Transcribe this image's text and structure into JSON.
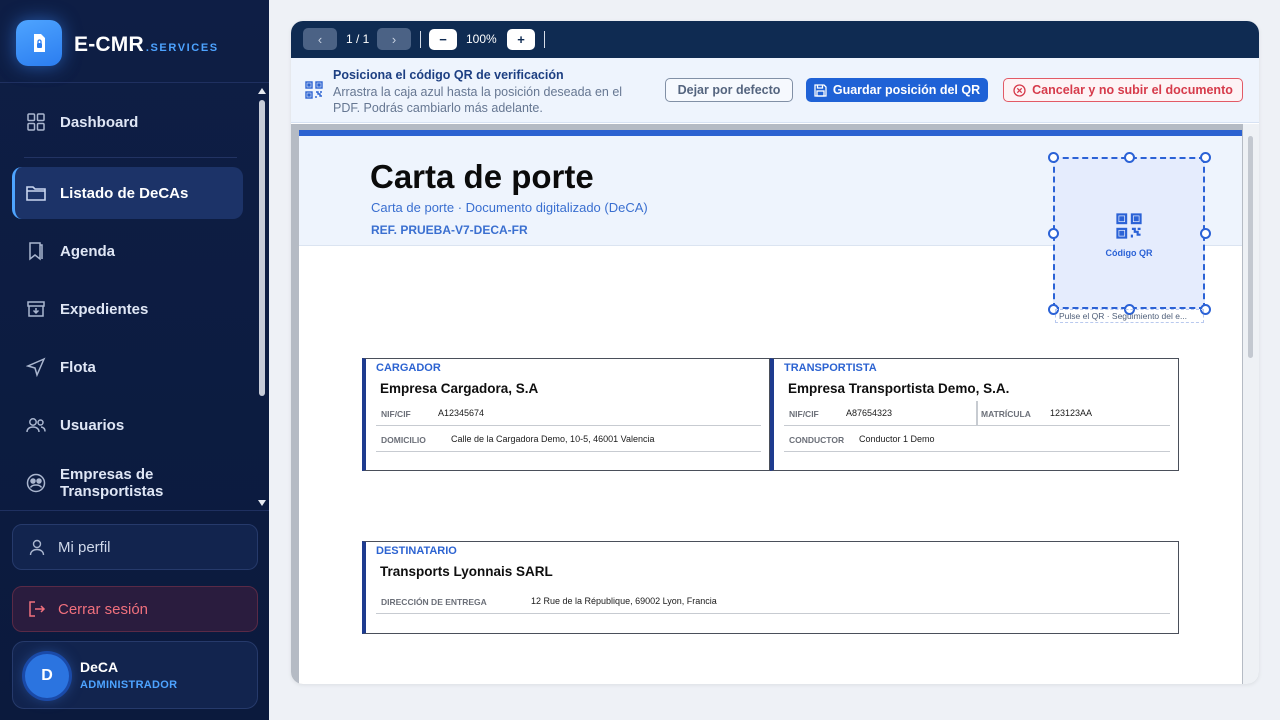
{
  "brand": {
    "name": "E-CMR",
    "sub": ".SERVICES"
  },
  "nav": {
    "items": [
      {
        "label": "Dashboard",
        "icon": "grid-icon"
      },
      {
        "label": "Listado de DeCAs",
        "icon": "folder-icon",
        "active": true
      },
      {
        "label": "Agenda",
        "icon": "bookmark-icon"
      },
      {
        "label": "Expedientes",
        "icon": "archive-icon"
      },
      {
        "label": "Flota",
        "icon": "navigation-icon"
      },
      {
        "label": "Usuarios",
        "icon": "users-icon"
      },
      {
        "label": "Empresas de\nTransportistas",
        "icon": "company-icon"
      }
    ]
  },
  "footer": {
    "profile_label": "Mi perfil",
    "logout_label": "Cerrar sesión",
    "user": {
      "initial": "D",
      "name": "DeCA",
      "role": "ADMINISTRADOR"
    }
  },
  "toolbar": {
    "page_indicator": "1 / 1",
    "zoom": "100%",
    "zoom_out": "−",
    "zoom_in": "+"
  },
  "qr_bar": {
    "title": "Posiciona el código QR de verificación",
    "description": "Arrastra la caja azul hasta la posición deseada en el PDF. Podrás cambiarlo más adelante.",
    "default_button": "Dejar por defecto",
    "save_button": "Guardar posición del QR",
    "cancel_button": "Cancelar y no subir el documento"
  },
  "document": {
    "title": "Carta de porte",
    "subtitle": "Carta de porte · Documento digitalizado (DeCA)",
    "reference": "REF. PRUEBA-V7-DECA-FR",
    "qr_label": "Código QR",
    "qr_caption": "Pulse el QR · Seguimiento del e...",
    "cargador": {
      "label": "CARGADOR",
      "name": "Empresa Cargadora, S.A",
      "nif_key": "NIF/CIF",
      "nif": "A12345674",
      "domicilio_key": "DOMICILIO",
      "domicilio": "Calle de la Cargadora Demo, 10-5, 46001 Valencia"
    },
    "transportista": {
      "label": "TRANSPORTISTA",
      "name": "Empresa Transportista Demo, S.A.",
      "nif_key": "NIF/CIF",
      "nif": "A87654323",
      "matricula_key": "MATRÍCULA",
      "matricula": "123123AA",
      "conductor_key": "CONDUCTOR",
      "conductor": "Conductor 1 Demo"
    },
    "destinatario": {
      "label": "DESTINATARIO",
      "name": "Transports Lyonnais SARL",
      "direccion_key": "DIRECCIÓN DE ENTREGA",
      "direccion": "12 Rue de la République, 69002 Lyon, Francia"
    }
  }
}
